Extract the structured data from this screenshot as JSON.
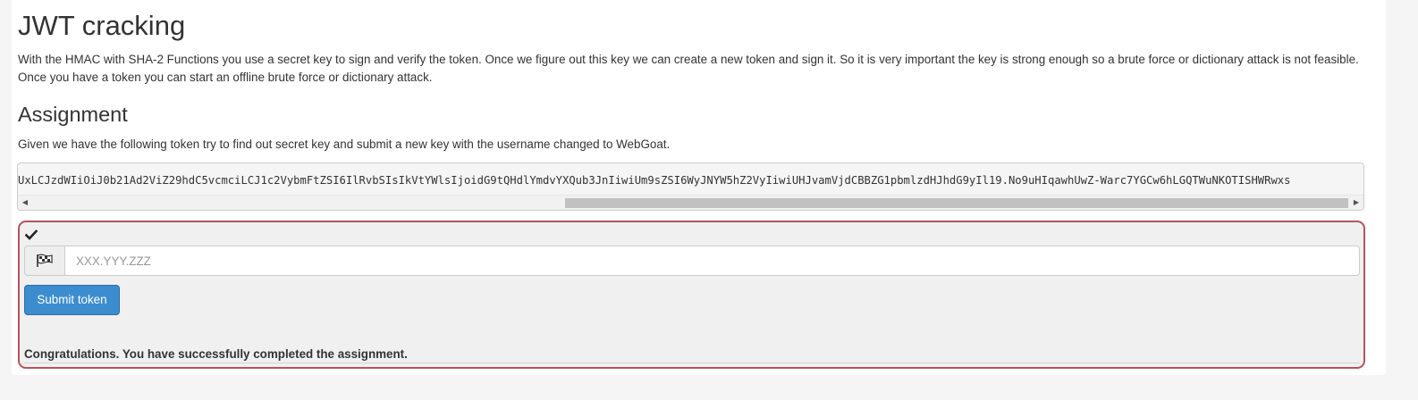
{
  "page": {
    "title": "JWT cracking",
    "intro": "With the HMAC with SHA-2 Functions you use a secret key to sign and verify the token. Once we figure out this key we can create a new token and sign it. So it is very important the key is strong enough so a brute force or dictionary attack is not feasible. Once you have a token you can start an offline brute force or dictionary attack."
  },
  "assignment": {
    "heading": "Assignment",
    "instructions": "Given we have the following token try to find out secret key and submit a new key with the username changed to WebGoat.",
    "token_visible": "UxLCJzdWIiOiJ0b21Ad2ViZ29hdC5vcmciLCJ1c2VybmFtZSI6IlRvbSIsIkVtYWlsIjoidG9tQHdlYmdvYXQub3JnIiwiUm9sZSI6WyJNYW5hZ2VyIiwiUHJvamVjdCBBZG1pbmlzdHJhdG9yIl19.No9uHIqawhUwZ-Warc7YGCw6hLGQTWuNKOTISHWRwxs"
  },
  "form": {
    "check_icon": "check-icon",
    "flag_icon": "flag-checkered-icon",
    "input_placeholder": "XXX.YYY.ZZZ",
    "input_value": "",
    "submit_label": "Submit token",
    "feedback": "Congratulations. You have successfully completed the assignment."
  },
  "colors": {
    "submit_button": "#3c8dd0",
    "form_border": "#b5545c",
    "form_background": "#f0f0f0"
  }
}
